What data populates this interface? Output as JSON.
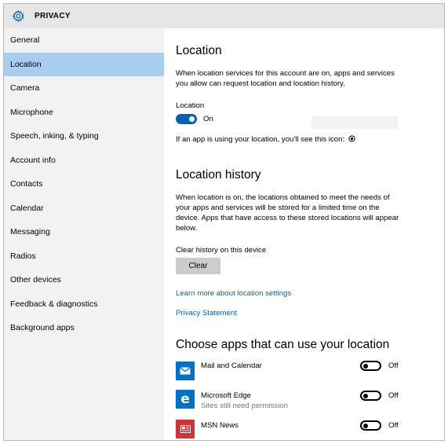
{
  "titlebar": {
    "title": "PRIVACY",
    "icon": "gear-icon"
  },
  "sidebar": {
    "items": [
      {
        "label": "General"
      },
      {
        "label": "Location"
      },
      {
        "label": "Camera"
      },
      {
        "label": "Microphone"
      },
      {
        "label": "Speech, inking, & typing"
      },
      {
        "label": "Account info"
      },
      {
        "label": "Contacts"
      },
      {
        "label": "Calendar"
      },
      {
        "label": "Messaging"
      },
      {
        "label": "Radios"
      },
      {
        "label": "Other devices"
      },
      {
        "label": "Feedback & diagnostics"
      },
      {
        "label": "Background apps"
      }
    ],
    "selected": "Location"
  },
  "location": {
    "heading": "Location",
    "description": "When location services for this account are on, apps and services you allow can request location and location history.",
    "toggle_label": "Location",
    "toggle_state": "On",
    "icon_note": "If an app is using your location, you'll see this icon:"
  },
  "history": {
    "heading": "Location history",
    "description": "When location is on, the locations obtained to meet the needs of your apps and services will be stored for a limited time on the device. Apps that have access to these stored locations will appear below.",
    "clear_label": "Clear history on this device",
    "clear_button": "Clear"
  },
  "links": {
    "learn_more": "Learn more about location settings",
    "privacy": "Privacy Statement"
  },
  "apps": {
    "heading": "Choose apps that can use your location",
    "items": [
      {
        "name": "Mail and Calendar",
        "subtitle": "",
        "state": "Off",
        "color": "#0072c6"
      },
      {
        "name": "Microsoft Edge",
        "subtitle": "Sites still need permission",
        "state": "Off",
        "color": "#0072c6"
      },
      {
        "name": "MSN News",
        "subtitle": "",
        "state": "Off",
        "color": "#d13438"
      }
    ]
  },
  "colors": {
    "accent": "#0063b1",
    "sidebar_selected": "#a8cdee",
    "sidebar_bg": "#f2f2f2",
    "titlebar_bg": "#e6e6e6"
  }
}
